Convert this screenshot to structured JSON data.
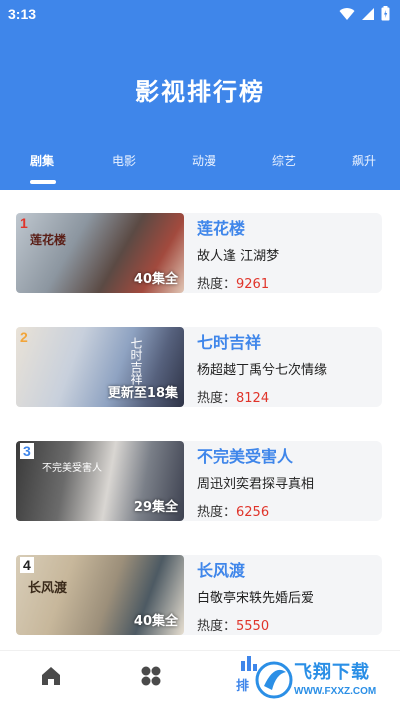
{
  "status_bar": {
    "time": "3:13"
  },
  "header": {
    "title": "影视排行榜"
  },
  "tabs": [
    {
      "label": "剧集",
      "active": true
    },
    {
      "label": "电影",
      "active": false
    },
    {
      "label": "动漫",
      "active": false
    },
    {
      "label": "综艺",
      "active": false
    },
    {
      "label": "飙升",
      "active": false
    }
  ],
  "items": [
    {
      "rank": "1",
      "rank_color": "#e0342a",
      "title": "莲花楼",
      "desc": "故人逢 江湖梦",
      "heat_label": "热度：",
      "heat": "9261",
      "episodes": "40集全",
      "poster_text": "莲花楼"
    },
    {
      "rank": "2",
      "rank_color": "#f2a53a",
      "title": "七时吉祥",
      "desc": "杨超越丁禹兮七次情缘",
      "heat_label": "热度：",
      "heat": "8124",
      "episodes": "更新至18集",
      "poster_text": "七时吉祥"
    },
    {
      "rank": "3",
      "rank_color": "#3f86ea",
      "title": "不完美受害人",
      "desc": "周迅刘奕君探寻真相",
      "heat_label": "热度：",
      "heat": "6256",
      "episodes": "29集全",
      "poster_text": "不完美受害人"
    },
    {
      "rank": "4",
      "rank_color": "#222222",
      "title": "长风渡",
      "desc": "白敬亭宋轶先婚后爱",
      "heat_label": "热度：",
      "heat": "5550",
      "episodes": "40集全",
      "poster_text": "长风渡"
    }
  ],
  "bottom_nav": {
    "items": [
      {
        "icon": "home-icon"
      },
      {
        "icon": "grid-icon"
      },
      {
        "icon": "ranking-icon",
        "label": "排"
      }
    ]
  },
  "watermark": {
    "text": "飞翔下载",
    "url": "WWW.FXXZ.COM"
  },
  "colors": {
    "primary": "#3f86ea",
    "heat": "#e0342a",
    "card_bg": "#f4f5f7"
  }
}
